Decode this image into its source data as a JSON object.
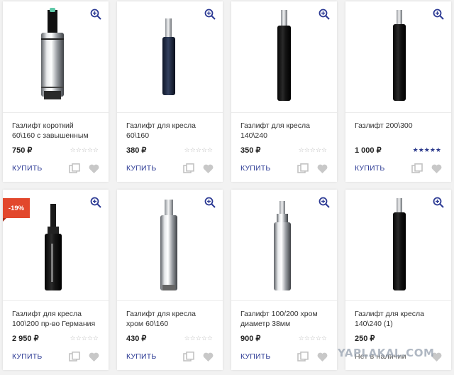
{
  "buy_label": "КУПИТЬ",
  "stock_label": "Нет в наличии",
  "colors": {
    "accent": "#2c3a94",
    "sale": "#e2472c",
    "star_filled": "#2b3a8c",
    "star_empty": "#b8b8b8"
  },
  "icons": {
    "zoom": "zoom-in-icon",
    "compare": "compare-icon",
    "favorite": "heart-icon"
  },
  "products": [
    {
      "title": "Газлифт короткий\n60\\160 с завышенным",
      "price": "750 ₽",
      "stars": "☆☆☆☆☆",
      "rating": 0
    },
    {
      "title": "Газлифт для кресла\n60\\160",
      "price": "380 ₽",
      "stars": "☆☆☆☆☆",
      "rating": 0
    },
    {
      "title": "Газлифт для кресла\n140\\240",
      "price": "350 ₽",
      "stars": "☆☆☆☆☆",
      "rating": 0
    },
    {
      "title": "Газлифт 200\\300",
      "price": "1 000 ₽",
      "stars": "★★★★★",
      "rating": 5
    },
    {
      "title": "Газлифт для кресла\n100\\200 пр-во Германия",
      "price": "2 950 ₽",
      "stars": "☆☆☆☆☆",
      "rating": 0,
      "badge": "-19%"
    },
    {
      "title": "Газлифт для кресла\nхром 60\\160",
      "price": "430 ₽",
      "stars": "☆☆☆☆☆",
      "rating": 0
    },
    {
      "title": "Газлифт 100/200 хром\nдиаметр 38мм",
      "price": "900 ₽",
      "stars": "☆☆☆☆☆",
      "rating": 0
    },
    {
      "title": "Газлифт для кресла\n140\\240 (1)",
      "price": "250 ₽",
      "stars": "",
      "rating": 0,
      "out_of_stock": true
    }
  ],
  "watermark": "YAPLAKAL.COM"
}
